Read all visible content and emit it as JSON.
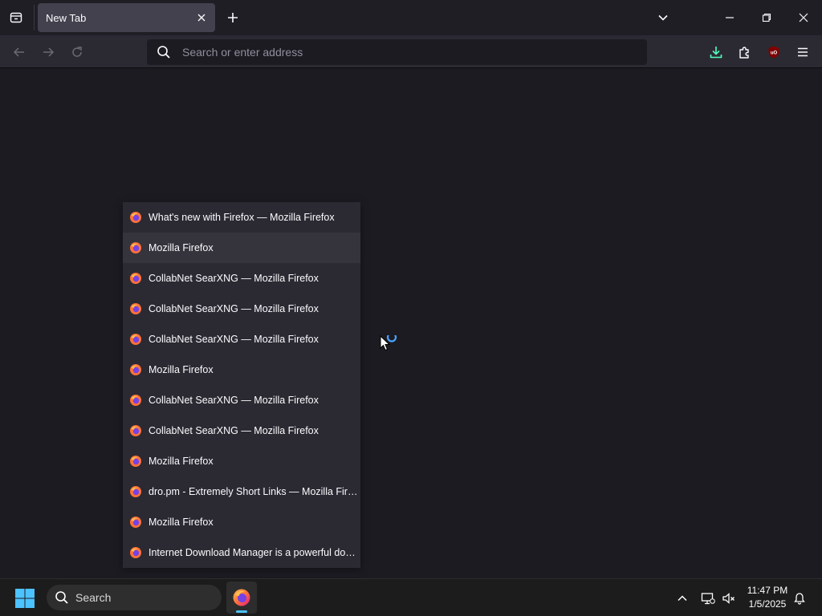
{
  "browser": {
    "tab": {
      "title": "New Tab"
    },
    "urlbar": {
      "placeholder": "Search or enter address"
    }
  },
  "history_menu": {
    "items": [
      {
        "label": "What's new with Firefox — Mozilla Firefox"
      },
      {
        "label": "Mozilla Firefox",
        "state": "hovered"
      },
      {
        "label": "CollabNet SearXNG — Mozilla Firefox"
      },
      {
        "label": "CollabNet SearXNG — Mozilla Firefox"
      },
      {
        "label": "CollabNet SearXNG — Mozilla Firefox"
      },
      {
        "label": "Mozilla Firefox"
      },
      {
        "label": "CollabNet SearXNG — Mozilla Firefox"
      },
      {
        "label": "CollabNet SearXNG — Mozilla Firefox"
      },
      {
        "label": "Mozilla Firefox"
      },
      {
        "label": "dro.pm - Extremely Short Links — Mozilla Firefox"
      },
      {
        "label": "Mozilla Firefox"
      },
      {
        "label": "Internet Download Manager is a powerful dow..."
      }
    ]
  },
  "taskbar": {
    "search_label": "Search",
    "time": "11:47 PM",
    "date": "1/5/2025"
  },
  "icons": {
    "firefox": "firefox-icon",
    "ublock": "ublock-origin-icon",
    "download": "download-icon"
  },
  "colors": {
    "accent": "#4cc2ff",
    "download_accent": "#54ffbd",
    "ublock_red": "#800000"
  }
}
